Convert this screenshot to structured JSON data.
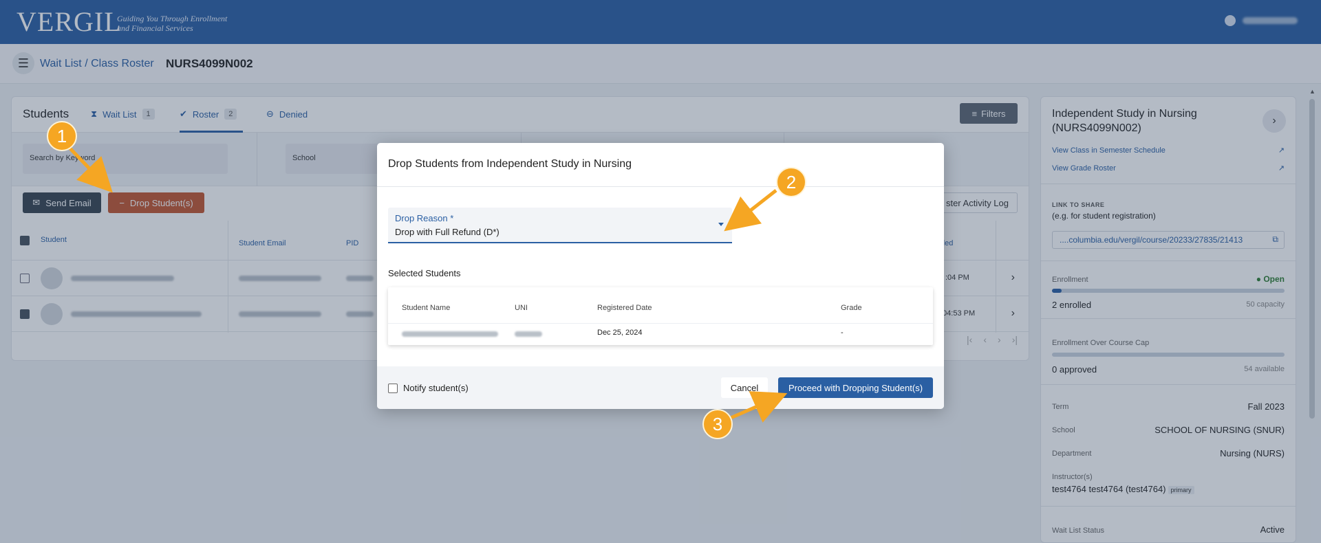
{
  "header": {
    "logo_text": "VERGIL",
    "tagline_line1": "Guiding You Through Enrollment",
    "tagline_line2": "and Financial Services"
  },
  "subheader": {
    "breadcrumb": "Wait List / Class Roster",
    "class_code": "NURS4099N002"
  },
  "tabs": {
    "title": "Students",
    "waitlist_label": "Wait List",
    "waitlist_count": "1",
    "roster_label": "Roster",
    "roster_count": "2",
    "denied_label": "Denied",
    "filters_label": "Filters"
  },
  "filters": {
    "keyword_placeholder": "Search by Keyword",
    "school_label": "School"
  },
  "actions": {
    "send_email": "Send Email",
    "drop_students": "Drop Student(s)",
    "roster_log": "ster Activity Log"
  },
  "table": {
    "col_student": "Student",
    "col_email": "Student Email",
    "col_pid": "PID",
    "col_added": "ded",
    "rows": [
      {
        "time": ":04 PM",
        "checked": false
      },
      {
        "time": ":04:53 PM",
        "checked": true
      }
    ]
  },
  "side": {
    "title": "Independent Study in Nursing (NURS4099N002)",
    "link_schedule": "View Class in Semester Schedule",
    "link_grade": "View Grade Roster",
    "share_heading": "LINK TO SHARE",
    "share_sub": "(e.g. for student registration)",
    "share_url": "....columbia.edu/vergil/course/20233/27835/21413",
    "enrollment_label": "Enrollment",
    "enrollment_status": "● Open",
    "enrolled": "2 enrolled",
    "capacity": "50 capacity",
    "enrollment_fraction": 0.04,
    "overcap_label": "Enrollment Over Course Cap",
    "approved": "0 approved",
    "available": "54 available",
    "overcap_fraction": 0.0,
    "term_label": "Term",
    "term_value": "Fall 2023",
    "school_label": "School",
    "school_value": "SCHOOL OF NURSING (SNUR)",
    "dept_label": "Department",
    "dept_value": "Nursing (NURS)",
    "instructor_label": "Instructor(s)",
    "instructor_value": "test4764 test4764 (test4764)",
    "instructor_badge": "primary",
    "waitlist_label": "Wait List Status",
    "waitlist_value": "Active"
  },
  "modal": {
    "title": "Drop Students from Independent Study in Nursing",
    "reason_label": "Drop Reason *",
    "reason_value": "Drop with Full Refund (D*)",
    "selected_title": "Selected Students",
    "col_name": "Student Name",
    "col_uni": "UNI",
    "col_registered": "Registered Date",
    "col_grade": "Grade",
    "row_registered": "Dec 25, 2024",
    "row_grade": "-",
    "notify_label": "Notify student(s)",
    "cancel": "Cancel",
    "proceed": "Proceed with Dropping Student(s)"
  },
  "annotations": {
    "m1": "1",
    "m2": "2",
    "m3": "3"
  },
  "colors": {
    "brand": "#2a5fa3",
    "drop": "#c2552f",
    "marker": "#f5a623",
    "open": "#2e7d32"
  }
}
